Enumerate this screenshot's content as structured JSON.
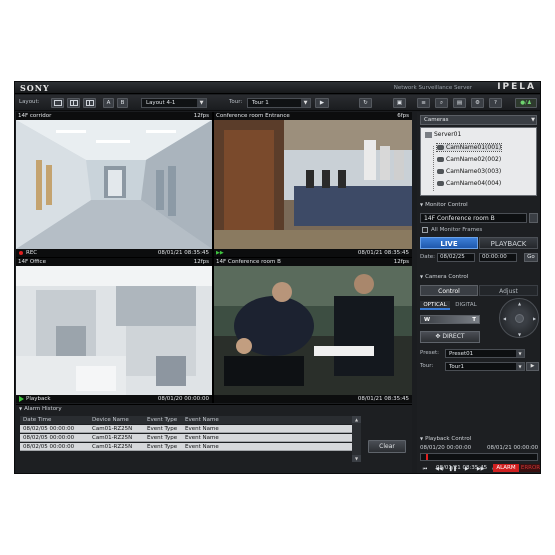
{
  "app": {
    "brand": "SONY",
    "product": "Network Surveillance Server",
    "logo": "IPELA"
  },
  "toolbar": {
    "layout_label": "Layout:",
    "layout_value": "Layout 4-1",
    "tour_label": "Tour:",
    "tour_value": "Tour 1",
    "btn_a": "A",
    "btn_b": "B"
  },
  "monitors": [
    {
      "name": "14F corridor",
      "fps": "12fps",
      "status": "REC",
      "timestamp": "08/01/21 08:35:45",
      "icon": "rec-dot"
    },
    {
      "name": "Conference room Entrance",
      "fps": "6fps",
      "status": "",
      "timestamp": "08/01/21 08:35:45",
      "icon": "fast-forward-icon"
    },
    {
      "name": "14F Office",
      "fps": "12fps",
      "status": "Playback",
      "timestamp": "08/01/20 00:00:00",
      "icon": "play-icon"
    },
    {
      "name": "14F Conference room B",
      "fps": "12fps",
      "status": "",
      "timestamp": "08/01/21 08:35:45",
      "icon": ""
    }
  ],
  "alarm_history": {
    "title": "Alarm History",
    "columns": [
      "Date Time",
      "Device Name",
      "Event Type",
      "Event Name"
    ],
    "rows": [
      [
        "08/02/05 00:00:00",
        "Cam01-RZ25N",
        "Event Type",
        "Event Name"
      ],
      [
        "08/02/05 00:00:00",
        "Cam01-RZ25N",
        "Event Type",
        "Event Name"
      ],
      [
        "08/02/05 00:00:00",
        "Cam01-RZ25N",
        "Event Type",
        "Event Name"
      ]
    ],
    "clear_label": "Clear"
  },
  "cameras": {
    "select_value": "Cameras",
    "server": "Server01",
    "items": [
      "CamName01(001)",
      "CamName02(002)",
      "CamName03(003)",
      "CamName04(004)"
    ]
  },
  "monitor_control": {
    "title": "Monitor Control",
    "selected": "14F Conference room B",
    "all_frames_label": "All Monitor Frames",
    "live_label": "LIVE",
    "playback_label": "PLAYBACK",
    "date_label": "Date:",
    "date_value": "08/02/25",
    "time_value": "00:00:00",
    "go_label": "Go"
  },
  "camera_control": {
    "title": "Camera Control",
    "tab_control": "Control",
    "tab_adjust": "Adjust",
    "optical": "OPTICAL",
    "digital": "DIGITAL",
    "wide": "W",
    "tele": "T",
    "direct": "DIRECT",
    "preset_label": "Preset:",
    "preset_value": "Preset01",
    "tour_label": "Tour:",
    "tour_value": "Tour1"
  },
  "playback_control": {
    "title": "Playback Control",
    "start": "08/01/20 00:00:00",
    "end": "08/01/21 00:00:00"
  },
  "status_bar": {
    "time": "08/01/21 08:35:45",
    "alarm": "ALARM",
    "error": "ERROR"
  },
  "colors": {
    "accent": "#3a7bd5",
    "alarm": "#d02020",
    "rec": "#e02020",
    "play": "#3fc43f"
  }
}
